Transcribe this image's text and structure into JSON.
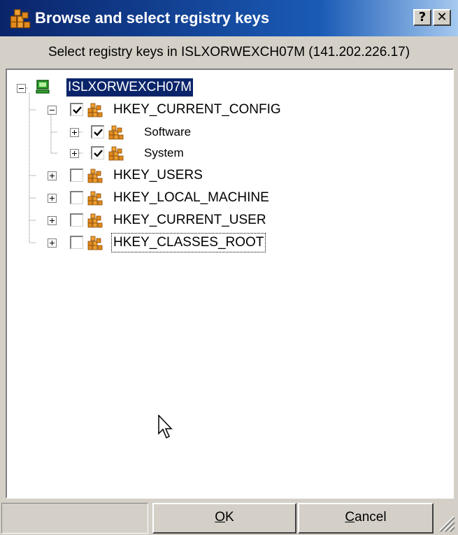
{
  "window": {
    "title": "Browse and select registry keys",
    "help_label": "?",
    "close_label": "✕",
    "subtitle": "Select registry keys in ISLXORWEXCH07M (141.202.226.17)"
  },
  "tree": {
    "root": {
      "label": "ISLXORWEXCH07M",
      "icon": "computer-icon",
      "selected": true
    },
    "keys": [
      {
        "label": "HKEY_CURRENT_CONFIG",
        "checked": true,
        "expanded": true,
        "children": [
          {
            "label": "Software",
            "checked": true
          },
          {
            "label": "System",
            "checked": true
          }
        ]
      },
      {
        "label": "HKEY_USERS",
        "checked": false
      },
      {
        "label": "HKEY_LOCAL_MACHINE",
        "checked": false
      },
      {
        "label": "HKEY_CURRENT_USER",
        "checked": false
      },
      {
        "label": "HKEY_CLASSES_ROOT",
        "checked": false,
        "focused": true
      }
    ]
  },
  "buttons": {
    "ok_accel": "O",
    "ok_rest": "K",
    "cancel_accel": "C",
    "cancel_rest": "ancel"
  },
  "colors": {
    "title_bar": "#0a246a",
    "selection": "#0a246a",
    "dialog_face": "#d4d0c8",
    "registry_icon": "#e08a1e",
    "computer_icon": "#2ea02e"
  }
}
